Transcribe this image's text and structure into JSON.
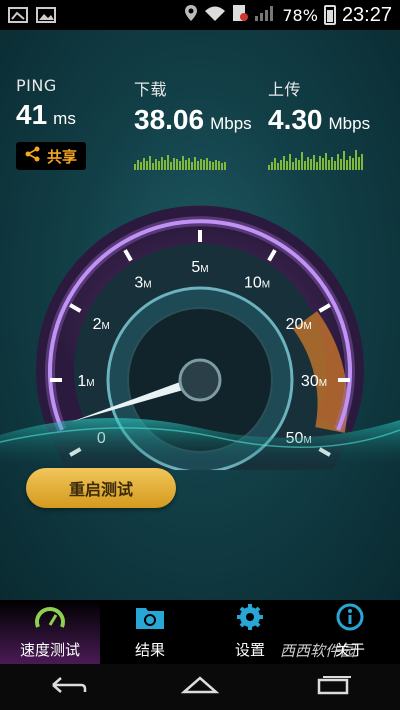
{
  "status_bar": {
    "battery": "78%",
    "time": "23:27"
  },
  "metrics": {
    "ping": {
      "label": "PING",
      "value": "41",
      "unit": "ms"
    },
    "download": {
      "label": "下载",
      "value": "38.06",
      "unit": "Mbps"
    },
    "upload": {
      "label": "上传",
      "value": "4.30",
      "unit": "Mbps"
    }
  },
  "share_label": "共享",
  "gauge": {
    "ticks": [
      {
        "v": "0",
        "u": ""
      },
      {
        "v": "1",
        "u": "M"
      },
      {
        "v": "2",
        "u": "M"
      },
      {
        "v": "3",
        "u": "M"
      },
      {
        "v": "5",
        "u": "M"
      },
      {
        "v": "10",
        "u": "M"
      },
      {
        "v": "20",
        "u": "M"
      },
      {
        "v": "30",
        "u": "M"
      },
      {
        "v": "50",
        "u": "M"
      }
    ],
    "needle_value": 0.4,
    "accent": "#a86fe0",
    "range_color": "#d07a2a"
  },
  "restart_label": "重启测试",
  "tabs": [
    {
      "label": "速度测试",
      "icon": "speedometer-icon",
      "active": true
    },
    {
      "label": "结果",
      "icon": "results-folder-icon",
      "active": false
    },
    {
      "label": "设置",
      "icon": "gear-icon",
      "active": false
    },
    {
      "label": "关于",
      "icon": "info-icon",
      "active": false
    }
  ],
  "watermark": "西西软件园"
}
